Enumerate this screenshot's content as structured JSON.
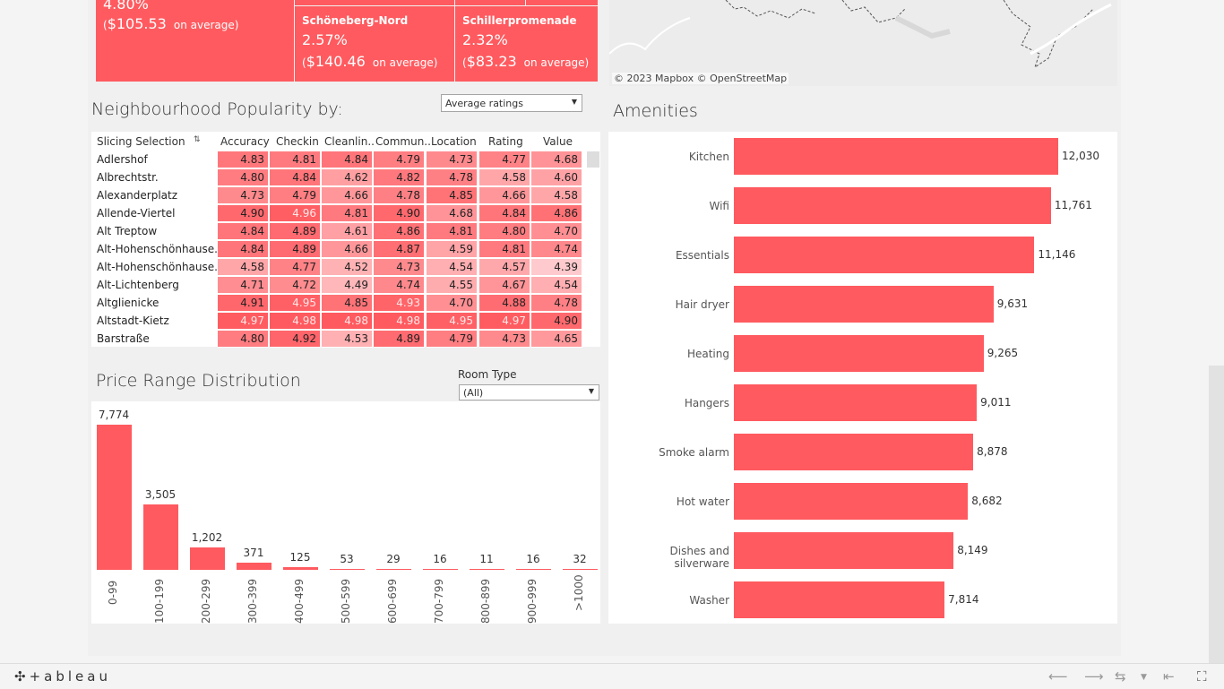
{
  "kpis": [
    {
      "name": "",
      "pct": "4.80%",
      "avg_value": "$105.53",
      "avg_text": "on average)"
    },
    {
      "name": "Schöneberg-Nord",
      "pct": "2.57%",
      "avg_value": "$140.46",
      "avg_text": "on average)"
    },
    {
      "name": "Schillerpromenade",
      "pct": "2.32%",
      "avg_value": "$83.23",
      "avg_text": "on average)"
    }
  ],
  "map": {
    "credit": "© 2023 Mapbox  © OpenStreetMap"
  },
  "popularity": {
    "title": "Neighbourhood Popularity by:",
    "metric_dropdown": "Average ratings",
    "columns": [
      "Slicing Selection",
      "Accuracy",
      "Checkin",
      "Cleanlin..",
      "Commun..",
      "Location",
      "Rating",
      "Value"
    ],
    "rows": [
      {
        "name": "Adlershof",
        "values": [
          "4.83",
          "4.81",
          "4.84",
          "4.79",
          "4.73",
          "4.77",
          "4.68"
        ]
      },
      {
        "name": "Albrechtstr.",
        "values": [
          "4.80",
          "4.84",
          "4.62",
          "4.82",
          "4.78",
          "4.58",
          "4.60"
        ]
      },
      {
        "name": "Alexanderplatz",
        "values": [
          "4.73",
          "4.79",
          "4.66",
          "4.78",
          "4.85",
          "4.66",
          "4.58"
        ]
      },
      {
        "name": "Allende-Viertel",
        "values": [
          "4.90",
          "4.96",
          "4.81",
          "4.90",
          "4.68",
          "4.84",
          "4.86"
        ]
      },
      {
        "name": "Alt  Treptow",
        "values": [
          "4.84",
          "4.89",
          "4.61",
          "4.86",
          "4.81",
          "4.80",
          "4.70"
        ]
      },
      {
        "name": "Alt-Hohenschönhause..",
        "values": [
          "4.84",
          "4.89",
          "4.66",
          "4.87",
          "4.59",
          "4.81",
          "4.74"
        ]
      },
      {
        "name": "Alt-Hohenschönhause..",
        "values": [
          "4.58",
          "4.77",
          "4.52",
          "4.73",
          "4.54",
          "4.57",
          "4.39"
        ]
      },
      {
        "name": "Alt-Lichtenberg",
        "values": [
          "4.71",
          "4.72",
          "4.49",
          "4.74",
          "4.55",
          "4.67",
          "4.54"
        ]
      },
      {
        "name": "Altglienicke",
        "values": [
          "4.91",
          "4.95",
          "4.85",
          "4.93",
          "4.70",
          "4.88",
          "4.78"
        ]
      },
      {
        "name": "Altstadt-Kietz",
        "values": [
          "4.97",
          "4.98",
          "4.98",
          "4.98",
          "4.95",
          "4.97",
          "4.90"
        ]
      },
      {
        "name": "Barstraße",
        "values": [
          "4.80",
          "4.92",
          "4.53",
          "4.89",
          "4.79",
          "4.73",
          "4.65"
        ]
      }
    ]
  },
  "price": {
    "title": "Price Range Distribution",
    "room_type_label": "Room Type",
    "room_type_value": "(All)"
  },
  "amenities": {
    "title": "Amenities"
  },
  "chart_data": [
    {
      "type": "bar",
      "categories": [
        "0-99",
        "100-199",
        "200-299",
        "300-399",
        "400-499",
        "500-599",
        "600-699",
        "700-799",
        "800-899",
        "900-999",
        ">1000"
      ],
      "values": [
        7774,
        3505,
        1202,
        371,
        125,
        53,
        29,
        16,
        11,
        16,
        32
      ],
      "value_labels": [
        "7,774",
        "3,505",
        "1,202",
        "371",
        "125",
        "53",
        "29",
        "16",
        "11",
        "16",
        "32"
      ],
      "title": "Price Range Distribution",
      "color": "#ff5a5f"
    },
    {
      "type": "bar",
      "orientation": "horizontal",
      "categories": [
        "Kitchen",
        "Wifi",
        "Essentials",
        "Hair dryer",
        "Heating",
        "Hangers",
        "Smoke alarm",
        "Hot water",
        "Dishes and silverware",
        "Washer"
      ],
      "values": [
        12030,
        11761,
        11146,
        9631,
        9265,
        9011,
        8878,
        8682,
        8149,
        7814
      ],
      "value_labels": [
        "12,030",
        "11,761",
        "11,146",
        "9,631",
        "9,265",
        "9,011",
        "8,878",
        "8,682",
        "8,149",
        "7,814"
      ],
      "title": "Amenities",
      "color": "#ff5a5f"
    }
  ],
  "footer": {
    "logo": "+ableau"
  },
  "colors": {
    "accent": "#ff5a5f"
  }
}
